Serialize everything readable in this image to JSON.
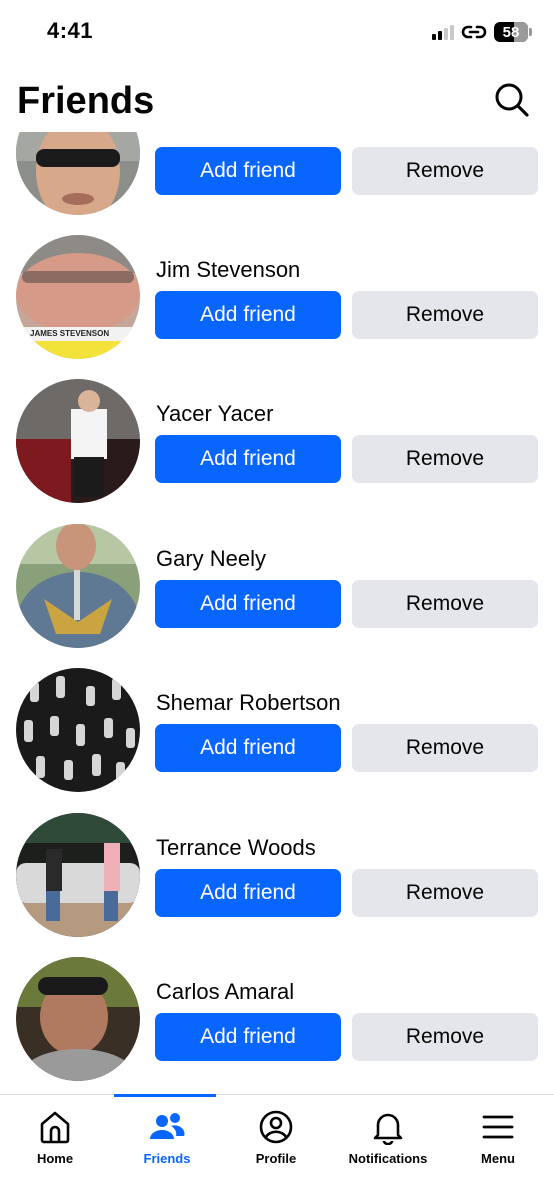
{
  "status_bar": {
    "time": "4:41",
    "battery": "58"
  },
  "header": {
    "title": "Friends",
    "search_icon": "search-icon"
  },
  "friends": [
    {
      "name": "",
      "add_label": "Add friend",
      "remove_label": "Remove"
    },
    {
      "name": "Jim Stevenson",
      "add_label": "Add friend",
      "remove_label": "Remove",
      "avatar_caption": "JAMES STEVENSON"
    },
    {
      "name": "Yacer Yacer",
      "add_label": "Add friend",
      "remove_label": "Remove"
    },
    {
      "name": "Gary Neely",
      "add_label": "Add friend",
      "remove_label": "Remove"
    },
    {
      "name": "Shemar Robertson",
      "add_label": "Add friend",
      "remove_label": "Remove"
    },
    {
      "name": "Terrance Woods",
      "add_label": "Add friend",
      "remove_label": "Remove"
    },
    {
      "name": "Carlos Amaral",
      "add_label": "Add friend",
      "remove_label": "Remove"
    }
  ],
  "bottom_nav": {
    "items": [
      {
        "label": "Home",
        "icon": "home-icon",
        "active": false
      },
      {
        "label": "Friends",
        "icon": "friends-icon",
        "active": true
      },
      {
        "label": "Profile",
        "icon": "profile-icon",
        "active": false
      },
      {
        "label": "Notifications",
        "icon": "bell-icon",
        "active": false
      },
      {
        "label": "Menu",
        "icon": "menu-icon",
        "active": false
      }
    ]
  },
  "colors": {
    "primary_button": "#0866ff",
    "secondary_button": "#e4e6eb",
    "active_nav": "#0866ff",
    "text": "#050505"
  }
}
